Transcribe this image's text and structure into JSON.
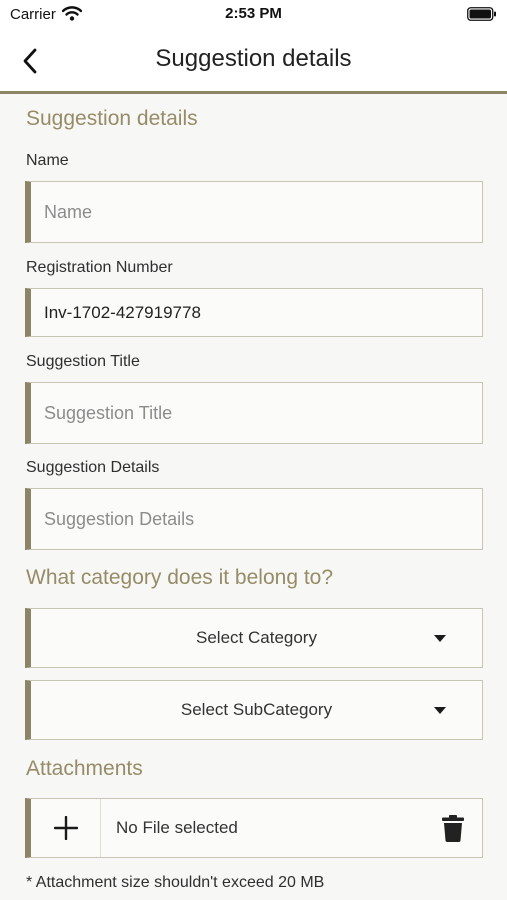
{
  "status_bar": {
    "carrier": "Carrier",
    "time": "2:53 PM"
  },
  "nav": {
    "title": "Suggestion details",
    "back_icon": "chevron-left-icon"
  },
  "form": {
    "section_title": "Suggestion details",
    "name_label": "Name",
    "name_placeholder": "Name",
    "registration_label": "Registration Number",
    "registration_value": "Inv-1702-427919778",
    "title_label": "Suggestion Title",
    "title_placeholder": "Suggestion Title",
    "details_label": "Suggestion Details",
    "details_placeholder": "Suggestion Details"
  },
  "category": {
    "heading": "What category does it belong to?",
    "select_category": "Select Category",
    "select_subcategory": "Select SubCategory"
  },
  "attachments": {
    "heading": "Attachments",
    "file_status": "No File selected",
    "note": "* Attachment size shouldn't exceed 20 MB"
  },
  "colors": {
    "accent": "#8b8466",
    "heading": "#968c67",
    "border": "#c8c4b3",
    "background": "#f7f7f5"
  }
}
